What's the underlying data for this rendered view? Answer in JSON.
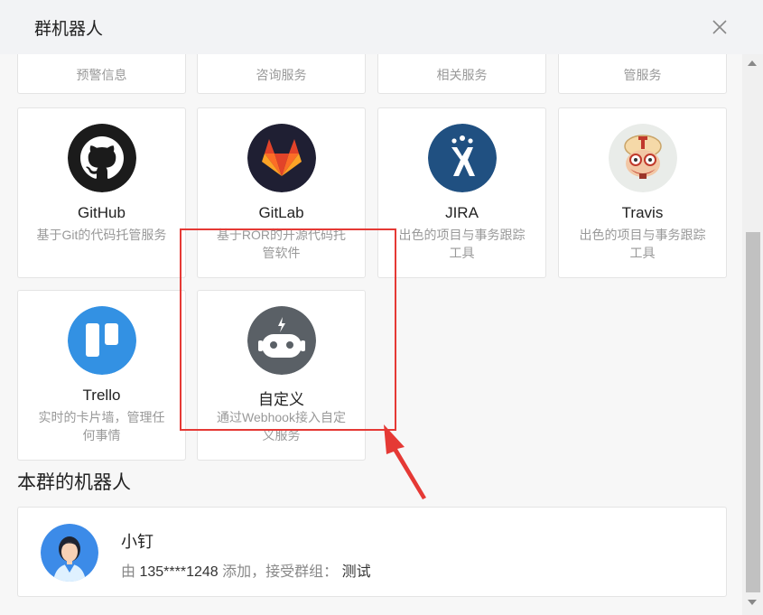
{
  "header": {
    "title": "群机器人"
  },
  "top_row": [
    {
      "desc": "预警信息"
    },
    {
      "desc": "咨询服务"
    },
    {
      "desc": "相关服务"
    },
    {
      "desc": "管服务"
    }
  ],
  "robots": [
    {
      "name": "GitHub",
      "desc": "基于Git的代码托管服务",
      "icon": "github-icon"
    },
    {
      "name": "GitLab",
      "desc": "基于ROR的开源代码托管软件",
      "icon": "gitlab-icon"
    },
    {
      "name": "JIRA",
      "desc": "出色的项目与事务跟踪工具",
      "icon": "jira-icon"
    },
    {
      "name": "Travis",
      "desc": "出色的项目与事务跟踪工具",
      "icon": "travis-icon"
    },
    {
      "name": "Trello",
      "desc": "实时的卡片墙，管理任何事情",
      "icon": "trello-icon"
    },
    {
      "name": "自定义",
      "desc": "通过Webhook接入自定义服务",
      "icon": "robot-icon"
    }
  ],
  "section_title": "本群的机器人",
  "member": {
    "name": "小钉",
    "prefix": "由",
    "phone": "135****1248",
    "middle": "添加，接受群组：",
    "group": "测试"
  },
  "colors": {
    "highlight": "#e53935",
    "accent": "#3296fa"
  }
}
